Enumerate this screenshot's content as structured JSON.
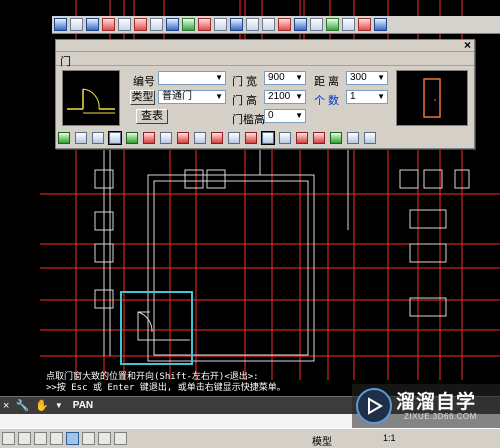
{
  "colors": {
    "canvas_bg": "#000000",
    "grid_red": "#ff2a2a",
    "wall_white": "#d9d9d9",
    "selection_cyan": "#3ec7d0",
    "preview_orange": "#e8743c",
    "preview_yellow": "#f0e040"
  },
  "dialog": {
    "title": "门",
    "close_icon": "×",
    "fields": {
      "number_label": "编号",
      "number_value": "",
      "type_button": "类型",
      "type_value": "普通门",
      "lookup_button": "查表",
      "width_label": "门  宽",
      "width_value": "900",
      "height_label": "门  高",
      "height_value": "2100",
      "sill_label": "门槛高",
      "sill_value": "0",
      "distance_label": "距  离",
      "distance_value": "300",
      "count_label": "个  数",
      "count_value": "1"
    }
  },
  "command": {
    "history_line1": "点取门窗大致的位置和开向(Shift-左右开)<退出>:",
    "history_line2": ">>按 Esc 或 Enter 键退出, 或单击右键显示快捷菜单。",
    "input_value": "PAN",
    "close_icon": "×",
    "wrench_icon": "wrench-icon",
    "pan_icon": "hand-icon"
  },
  "status": {
    "model_label": "模型",
    "scale_label": "1:1"
  },
  "watermark": {
    "brand": "溜溜自学",
    "url": "ZIXUE.3D66.COM"
  }
}
